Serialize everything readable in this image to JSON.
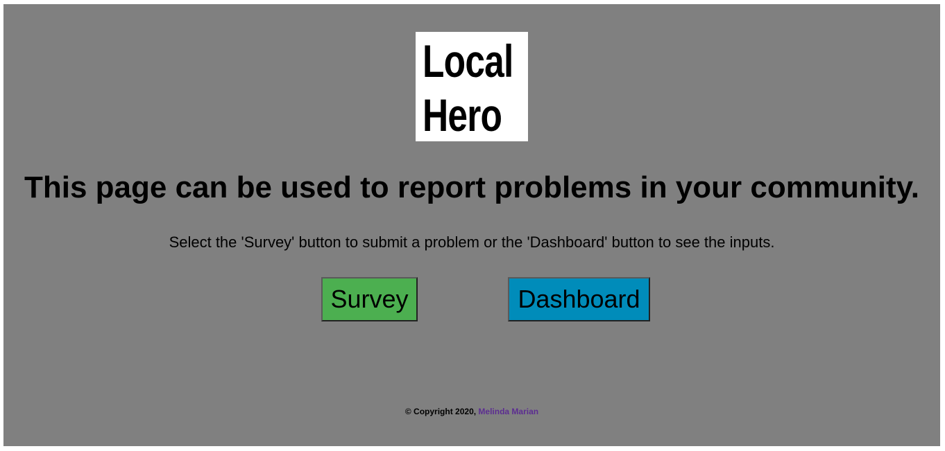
{
  "logo": {
    "line1": "Local",
    "line2": "Hero"
  },
  "headline": "This page can be used to report problems in your community.",
  "instructions": "Select the 'Survey' button to submit a problem or the 'Dashboard' button to see the inputs.",
  "buttons": {
    "survey_label": "Survey",
    "dashboard_label": "Dashboard"
  },
  "footer": {
    "copyright": "© Copyright 2020,",
    "author": "Melinda Marian"
  },
  "colors": {
    "background": "#808080",
    "survey_button": "#4caf50",
    "dashboard_button": "#008cba",
    "link": "#5c2d91"
  }
}
